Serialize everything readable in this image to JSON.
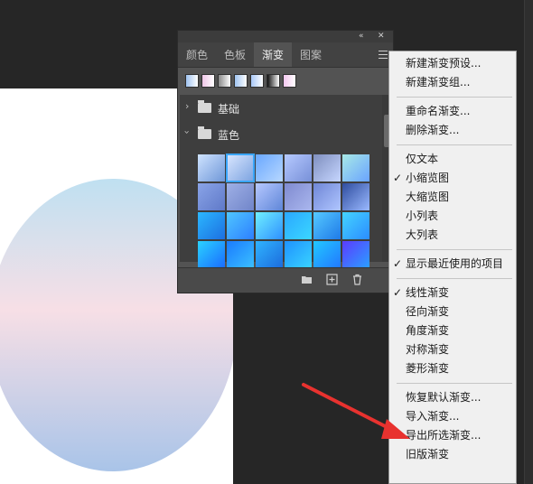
{
  "panel": {
    "collapse_icon": "double-chevron-icon",
    "close_icon": "close-icon",
    "tabs": [
      {
        "label": "颜色"
      },
      {
        "label": "色板"
      },
      {
        "label": "渐变"
      },
      {
        "label": "图案"
      }
    ],
    "active_tab": "渐变",
    "recent_swatch_colors": [
      "#9fc3f0",
      "#f0c6e8",
      "#8a8a8a",
      "#9fc3f0",
      "#a8c8f8",
      "#111111",
      "#f4c7ef"
    ],
    "groups": [
      {
        "label": "基础",
        "expanded": false
      },
      {
        "label": "蓝色",
        "expanded": true
      }
    ],
    "gradient_cells": [
      [
        "#cfe3ff",
        "#6f97d8"
      ],
      [
        "#dbe7ff",
        "#7aa2e0"
      ],
      [
        "#6aa8ff",
        "#b7d7ff"
      ],
      [
        "#b5c9ff",
        "#7890d8"
      ],
      [
        "#7f8fbf",
        "#c6d6ff"
      ],
      [
        "#a7e9e6",
        "#6aa3ff"
      ],
      [
        "#8aa4e8",
        "#5f79c8"
      ],
      [
        "#9fb0e6",
        "#7085c9"
      ],
      [
        "#b6c8ff",
        "#5f86d8"
      ],
      [
        "#7f8ad0",
        "#aab7ee"
      ],
      [
        "#6f86d6",
        "#b0c6ff"
      ],
      [
        "#2f4d9f",
        "#9ab9ff"
      ],
      [
        "#2bb7ff",
        "#1d6fe0"
      ],
      [
        "#4fc6ff",
        "#2d7fff"
      ],
      [
        "#6ff0ff",
        "#2e90ff"
      ],
      [
        "#2aa8ff",
        "#3bd6ff"
      ],
      [
        "#55c9ff",
        "#1f7ae8"
      ],
      [
        "#44d4ff",
        "#2b8cff"
      ],
      [
        "#2ad2ff",
        "#1a6bff"
      ],
      [
        "#1a7bff",
        "#3bc0ff"
      ],
      [
        "#2fb3ff",
        "#1c6bdc"
      ],
      [
        "#1f93ff",
        "#39d3ff"
      ],
      [
        "#22c8ff",
        "#2277ff"
      ],
      [
        "#5b3cff",
        "#2aa0ff"
      ]
    ],
    "selected_cell": 1,
    "bottom_icons": [
      "folder-icon",
      "new-gradient-icon",
      "trash-icon"
    ]
  },
  "menu": {
    "items": [
      {
        "label": "新建渐变预设...",
        "checked": false
      },
      {
        "label": "新建渐变组...",
        "checked": false
      },
      {
        "sep": true
      },
      {
        "label": "重命名渐变...",
        "checked": false
      },
      {
        "label": "删除渐变...",
        "checked": false
      },
      {
        "sep": true
      },
      {
        "label": "仅文本",
        "checked": false
      },
      {
        "label": "小缩览图",
        "checked": true
      },
      {
        "label": "大缩览图",
        "checked": false
      },
      {
        "label": "小列表",
        "checked": false
      },
      {
        "label": "大列表",
        "checked": false
      },
      {
        "sep": true
      },
      {
        "label": "显示最近使用的项目",
        "checked": true
      },
      {
        "sep": true
      },
      {
        "label": "线性渐变",
        "checked": true
      },
      {
        "label": "径向渐变",
        "checked": false
      },
      {
        "label": "角度渐变",
        "checked": false
      },
      {
        "label": "对称渐变",
        "checked": false
      },
      {
        "label": "菱形渐变",
        "checked": false
      },
      {
        "sep": true
      },
      {
        "label": "恢复默认渐变...",
        "checked": false
      },
      {
        "label": "导入渐变...",
        "checked": false
      },
      {
        "label": "导出所选渐变...",
        "checked": false
      },
      {
        "label": "旧版渐变",
        "checked": false
      }
    ],
    "check_glyph": "✓"
  },
  "colors": {
    "workspace": "#262626",
    "panel": "#535353",
    "menu_bg": "#f0f0f0",
    "arrow": "#e8322f",
    "selection": "#3aa6ff"
  }
}
